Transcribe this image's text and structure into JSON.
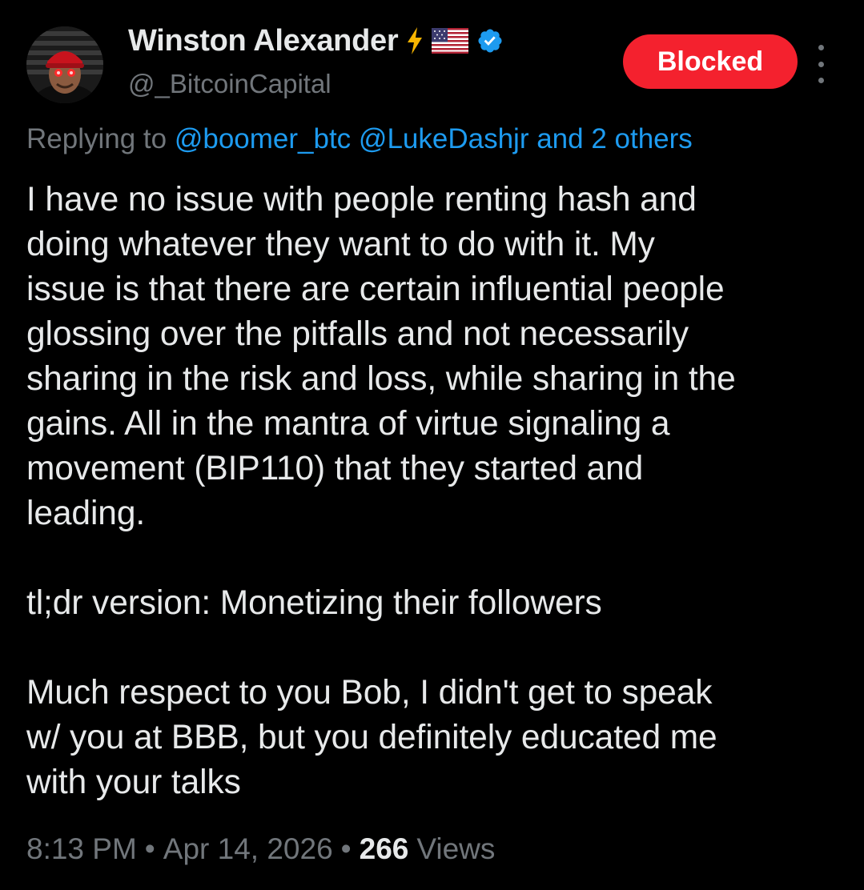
{
  "author": {
    "display_name": "Winston Alexander",
    "handle": "@_BitcoinCapital",
    "badges": [
      "lightning-bolt-icon",
      "us-flag-icon",
      "verified-badge-icon"
    ]
  },
  "actions": {
    "blocked_label": "Blocked",
    "more_icon": "more-vertical-icon"
  },
  "reply": {
    "prefix": "Replying to ",
    "mentions": "@boomer_btc @LukeDashjr and 2 others"
  },
  "tweet": {
    "paragraphs": [
      "I have no issue with people renting hash and\ndoing whatever they want to do with it. My\nissue is that there are certain influential people\nglossing over the pitfalls and not necessarily\nsharing in the risk and loss, while sharing in the\ngains. All in the mantra of virtue signaling a\nmovement (BIP110) that they started and\nleading.",
      "tl;dr version: Monetizing their followers",
      "Much respect to you Bob, I didn't get to speak\nw/ you at BBB, but you definitely educated me\nwith your talks"
    ]
  },
  "meta": {
    "time": "8:13 PM",
    "separator": "•",
    "date": "Apr 14, 2026",
    "views_count": "266",
    "views_label": "Views"
  },
  "colors": {
    "background": "#000000",
    "text": "#e7e9ea",
    "secondary": "#71767b",
    "link": "#1d9bf0",
    "blocked": "#f4212e",
    "verified": "#1d9bf0",
    "lightning": "#f7b500"
  }
}
